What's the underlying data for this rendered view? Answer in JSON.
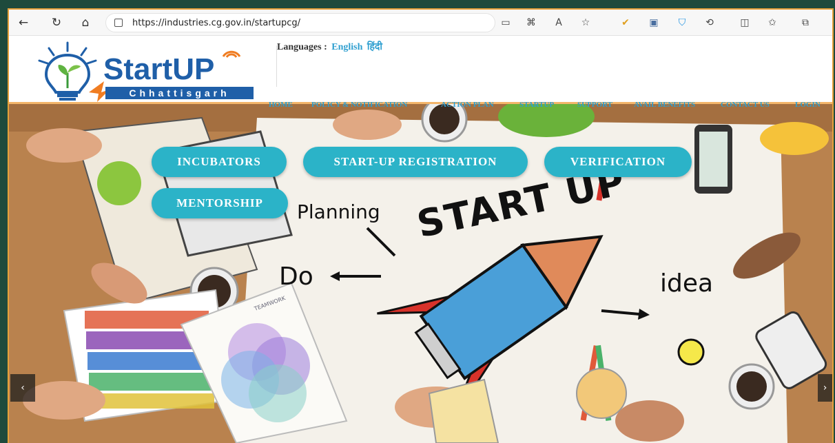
{
  "browser": {
    "url": "https://industries.cg.gov.in/startupcg/"
  },
  "site": {
    "logo_text": "StartUP",
    "logo_tagline": "Chhattisgarh",
    "languages_label": "Languages :",
    "lang_english": "English",
    "lang_hindi": "हिंदी"
  },
  "menu": {
    "items": [
      {
        "label": "HOME"
      },
      {
        "label": "POLICY & NOTIFICATION"
      },
      {
        "label": "ACTION PLAN"
      },
      {
        "label": "STARTUP"
      },
      {
        "label": "SUPPORT"
      },
      {
        "label": "AVAIL BENEFITS"
      },
      {
        "label": "CONTACT US"
      },
      {
        "label": "LOGIN"
      }
    ]
  },
  "hero": {
    "buttons": {
      "incubators": "INCUBATORS",
      "registration": "START-UP REGISTRATION",
      "verification": "VERIFICATION",
      "mentorship": "MENTORSHIP"
    },
    "illustration": {
      "headline": "START UP",
      "planning": "Planning",
      "do": "Do",
      "idea": "idea",
      "notebook": "TEAMWORK"
    },
    "prev": "‹",
    "next": "›"
  },
  "colors": {
    "accent": "#2bb3c8",
    "brand_blue": "#1f5fa8",
    "menu_text": "#2f9fd0"
  }
}
